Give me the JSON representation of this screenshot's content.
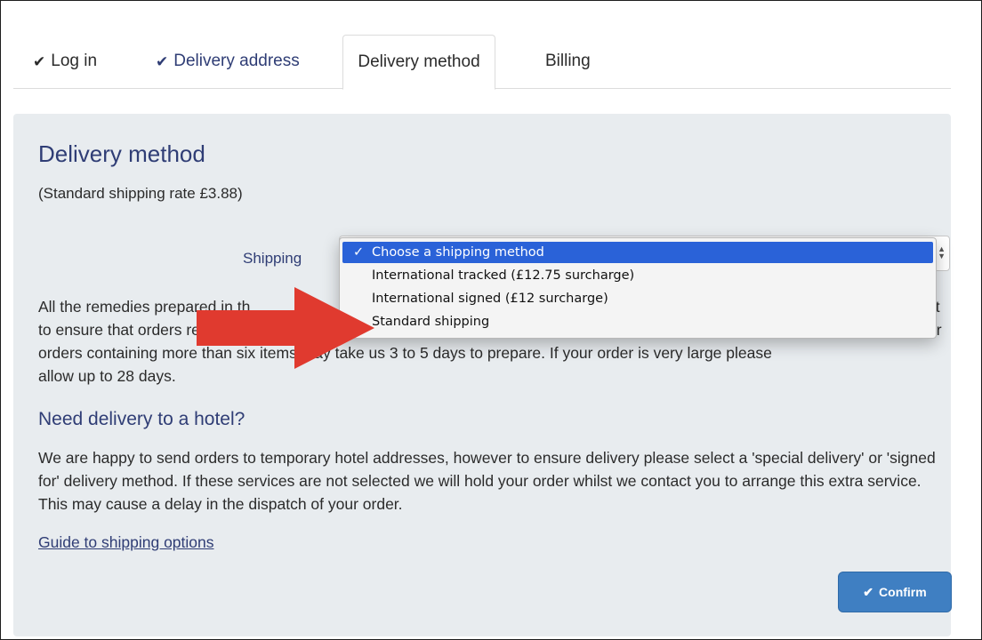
{
  "tabs": [
    {
      "label": "Log in",
      "checked": true
    },
    {
      "label": "Delivery address",
      "checked": true
    },
    {
      "label": "Delivery method",
      "checked": false,
      "active": true
    },
    {
      "label": "Billing",
      "checked": false
    }
  ],
  "check_glyph": "✔",
  "panel": {
    "title": "Delivery method",
    "rate_note": "(Standard shipping rate £3.88)",
    "shipping_label": "Shipping",
    "select": {
      "selected": "Choose a shipping method",
      "options": [
        "Choose a shipping method",
        "International tracked (£12.75 surcharge)",
        "International signed (£12 surcharge)",
        "Standard shipping"
      ]
    },
    "paragraph1_visible": "All the remedies prepared in th",
    "paragraph1_line2_visible": "to ensure that orders received",
    "paragraph1_line3": "orders containing more than six items may take us 3 to 5 days to prepare. If your order is very large please",
    "paragraph1_line4": "allow up to 28 days.",
    "paragraph1_right1": "st",
    "paragraph1_right2": "er",
    "hotel_heading": "Need delivery to a hotel?",
    "hotel_text": "We are happy to send orders to temporary hotel addresses, however to ensure delivery please select a 'special delivery' or 'signed for' delivery method. If these services are not selected we will hold your order whilst we contact you to arrange this extra service. This may cause a delay in the dispatch of your order.",
    "guide_link": "Guide to shipping options",
    "confirm_label": "Confirm"
  },
  "colors": {
    "accent": "#2f3d75",
    "panel_bg": "#e8ecef",
    "button": "#3f7fc2",
    "menu_selected": "#2a62d8",
    "arrow": "#e03a2f"
  }
}
